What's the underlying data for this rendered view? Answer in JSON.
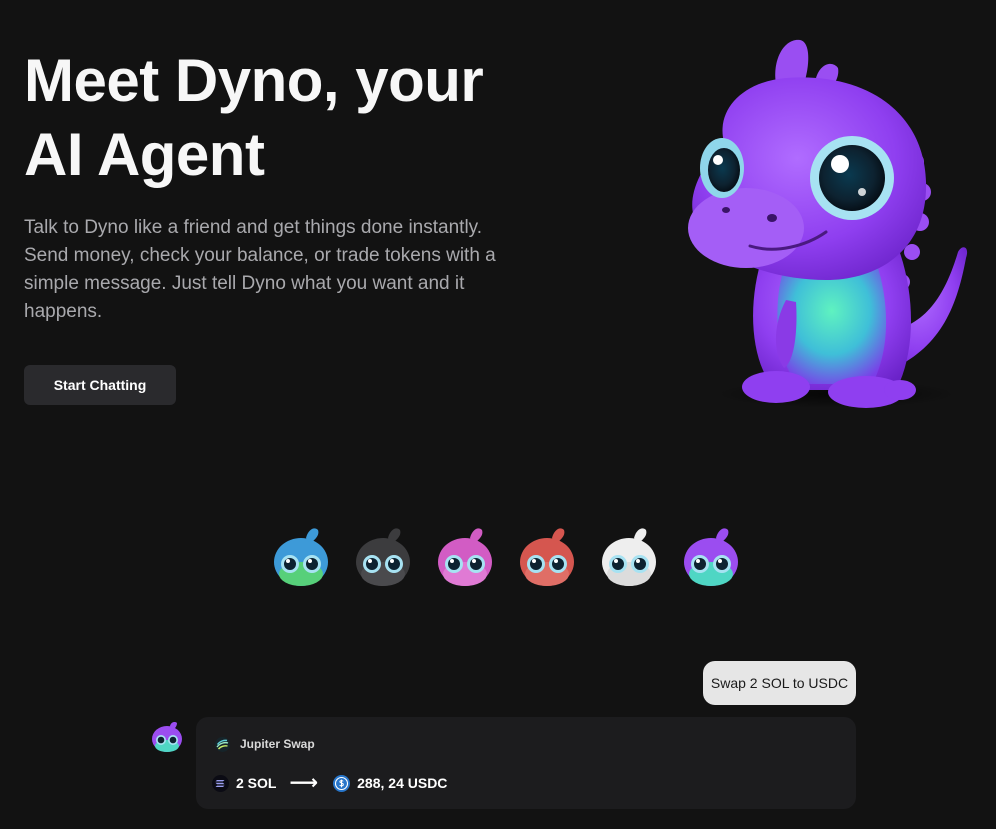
{
  "hero": {
    "title": "Meet Dyno, your AI Agent",
    "description": "Talk to Dyno like a friend and get things done instantly. Send money, check your balance, or trade tokens with a simple message. Just tell Dyno what you want and it happens.",
    "cta_label": "Start Chatting"
  },
  "mascot": {
    "icon": "purple-dino-mascot",
    "color": "#9b4df0"
  },
  "variants": [
    {
      "name": "blue",
      "body": "#3d9ad8",
      "icon": "dino-head-blue"
    },
    {
      "name": "black",
      "body": "#3c3c3e",
      "icon": "dino-head-black"
    },
    {
      "name": "pink",
      "body": "#d25cc4",
      "icon": "dino-head-pink"
    },
    {
      "name": "red",
      "body": "#d5564f",
      "icon": "dino-head-red"
    },
    {
      "name": "white",
      "body": "#eeeeee",
      "icon": "dino-head-white"
    },
    {
      "name": "purple",
      "body": "#9b4df0",
      "icon": "dino-head-purple"
    }
  ],
  "chat": {
    "user_message": "Swap 2 SOL to USDC",
    "bot": {
      "avatar_icon": "dino-avatar-purple",
      "provider": "Jupiter Swap",
      "provider_icon": "jupiter-logo-icon",
      "from_amount": "2 SOL",
      "from_icon": "solana-icon",
      "arrow_icon": "arrow-right-icon",
      "to_amount": "288, 24 USDC",
      "to_icon": "usdc-icon"
    }
  },
  "colors": {
    "background": "#121212",
    "button_bg": "#2a2a2d",
    "card_bg": "#1c1c1e",
    "user_bubble_bg": "#e6e6e6",
    "usdc_blue": "#2775ca"
  }
}
